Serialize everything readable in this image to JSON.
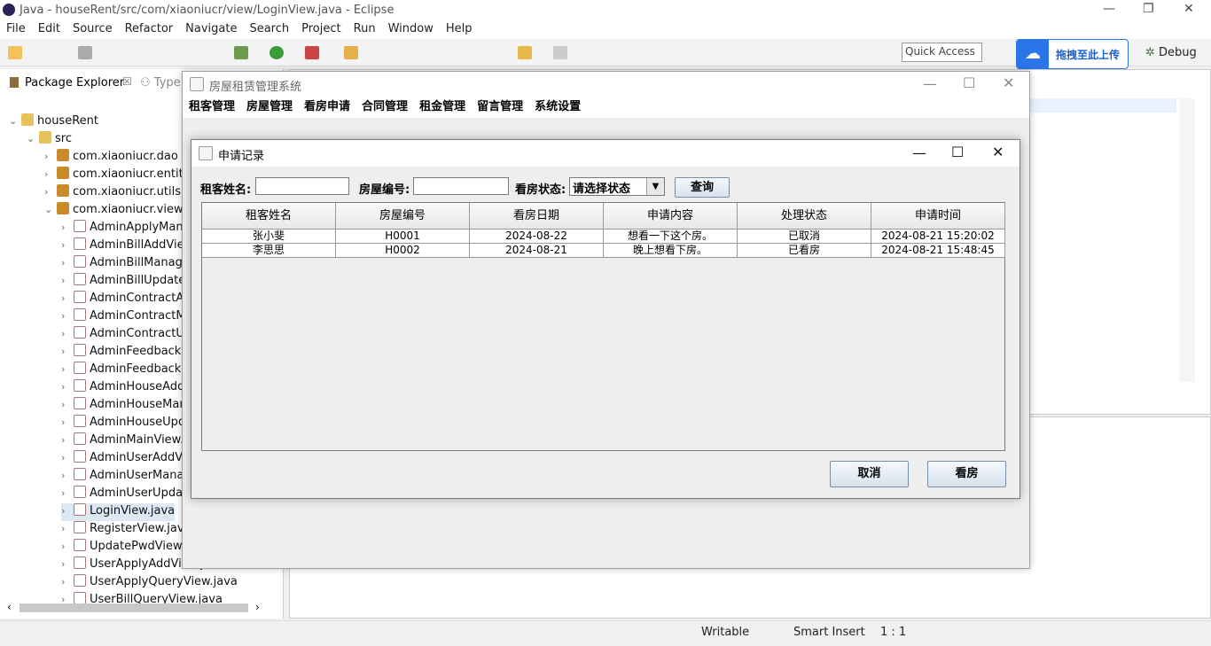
{
  "eclipse": {
    "window_title": "Java - houseRent/src/com/xiaoniucr/view/LoginView.java - Eclipse",
    "menu": [
      "File",
      "Edit",
      "Source",
      "Refactor",
      "Navigate",
      "Search",
      "Project",
      "Run",
      "Window",
      "Help"
    ],
    "quick_access": "Quick Access",
    "upload_label": "拖拽至此上传",
    "debug_label": "Debug",
    "package_explorer_tab": "Package Explorer",
    "type_tab": "Type",
    "tree": {
      "project": "houseRent",
      "src": "src",
      "packages": [
        "com.xiaoniucr.dao",
        "com.xiaoniucr.entity",
        "com.xiaoniucr.utils",
        "com.xiaoniucr.view"
      ],
      "files": [
        "AdminApplyMana",
        "AdminBillAddView",
        "AdminBillManage",
        "AdminBillUpdateV",
        "AdminContractAd",
        "AdminContractMa",
        "AdminContractUp",
        "AdminFeedbackM",
        "AdminFeedbackR",
        "AdminHouseAdd",
        "AdminHouseMan",
        "AdminHouseUpd",
        "AdminMainView.j",
        "AdminUserAddVi",
        "AdminUserManag",
        "AdminUserUpdat",
        "LoginView.java",
        "RegisterView.java",
        "UpdatePwdView.j",
        "UserApplyAddView.java",
        "UserApplyQueryView.java",
        "UserBillQueryView.java"
      ]
    },
    "status": {
      "writable": "Writable",
      "insert": "Smart Insert",
      "position": "1 : 1"
    }
  },
  "main_frame": {
    "title": "房屋租赁管理系统",
    "menu": [
      "租客管理",
      "房屋管理",
      "看房申请",
      "合同管理",
      "租金管理",
      "留言管理",
      "系统设置"
    ]
  },
  "dialog": {
    "title": "申请记录",
    "filters": {
      "tenant_label": "租客姓名:",
      "house_label": "房屋编号:",
      "status_label": "看房状态:",
      "status_value": "请选择状态",
      "query_button": "查询"
    },
    "columns": [
      "租客姓名",
      "房屋编号",
      "看房日期",
      "申请内容",
      "处理状态",
      "申请时间"
    ],
    "rows": [
      [
        "张小斐",
        "H0001",
        "2024-08-22",
        "想看一下这个房。",
        "已取消",
        "2024-08-21 15:20:02"
      ],
      [
        "李思思",
        "H0002",
        "2024-08-21",
        "晚上想看下房。",
        "已看房",
        "2024-08-21 15:48:45"
      ]
    ],
    "cancel_button": "取消",
    "view_button": "看房"
  }
}
